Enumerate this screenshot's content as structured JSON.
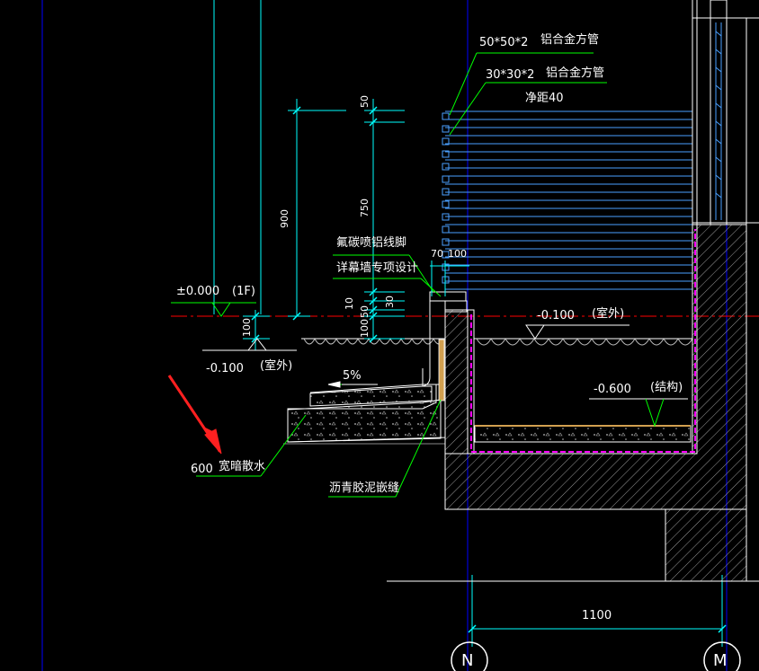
{
  "labels": {
    "tube_50": "50*50*2",
    "tube_50_name": "铝合金方管",
    "tube_30": "30*30*2",
    "tube_30_name": "铝合金方管",
    "clear_gap": "净距40",
    "skirting": "氟碳喷铝线脚",
    "curtain_wall": "详幕墙专项设计",
    "level_0": "±0.000",
    "level_0_floor": "(1F)",
    "level_outdoor_left": "-0.100",
    "outdoor_left": "(室外)",
    "level_outdoor_right": "-0.100",
    "outdoor_right": "(室外)",
    "level_structure": "-0.600",
    "structure": "(结构)",
    "slope": "5%",
    "apron_width": "600",
    "apron_name": "宽暗散水",
    "joint": "沥青胶泥嵌缝",
    "dim_50": "50",
    "dim_750": "750",
    "dim_900": "900",
    "dim_10": "10",
    "dim_50b": "50",
    "dim_100": "100",
    "dim_30": "30",
    "dim_70": "70",
    "dim_100b": "100",
    "dim_1100": "1100",
    "axis_n": "N",
    "axis_m": "M"
  },
  "colors": {
    "background": "#000000",
    "dimension": "#00ffff",
    "leader": "#00ff00",
    "section": "#ffffff",
    "membrane": "#ff00ff",
    "hatch": "#c0c0c0",
    "gridline": "#0000ff",
    "pointer": "#ff2020",
    "level_line": "#ff0000",
    "louver": "#1e90ff",
    "timber": "#d2a050"
  }
}
